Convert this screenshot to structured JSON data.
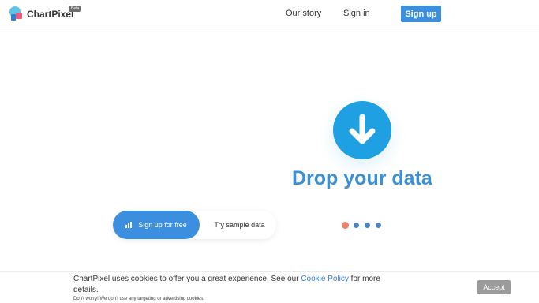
{
  "header": {
    "logo_text": "ChartPixel",
    "beta_badge": "Beta",
    "nav": {
      "our_story": "Our story",
      "sign_in": "Sign in",
      "sign_up": "Sign up"
    }
  },
  "hero": {
    "drop_heading": "Drop your data",
    "drop_icon": "arrow-down-icon",
    "cta": {
      "sign_up_free": "Sign up for free",
      "try_sample": "Try sample data"
    },
    "carousel": {
      "slide_count": 4,
      "active_index": 0
    }
  },
  "cookie": {
    "text_before": "ChartPixel uses cookies to offer you a great experience. See our ",
    "link": "Cookie Policy",
    "text_after": " for more details.",
    "small_print": "Don't worry! We don't use any targeting or advertising cookies.",
    "accept": "Accept"
  },
  "colors": {
    "primary": "#3b8fde",
    "drop_circle": "#1fa0e3",
    "heading": "#3b8fd6",
    "dot_active": "#f0806a",
    "dot": "#4a86c6",
    "accept_bg": "#9b9b9b"
  }
}
